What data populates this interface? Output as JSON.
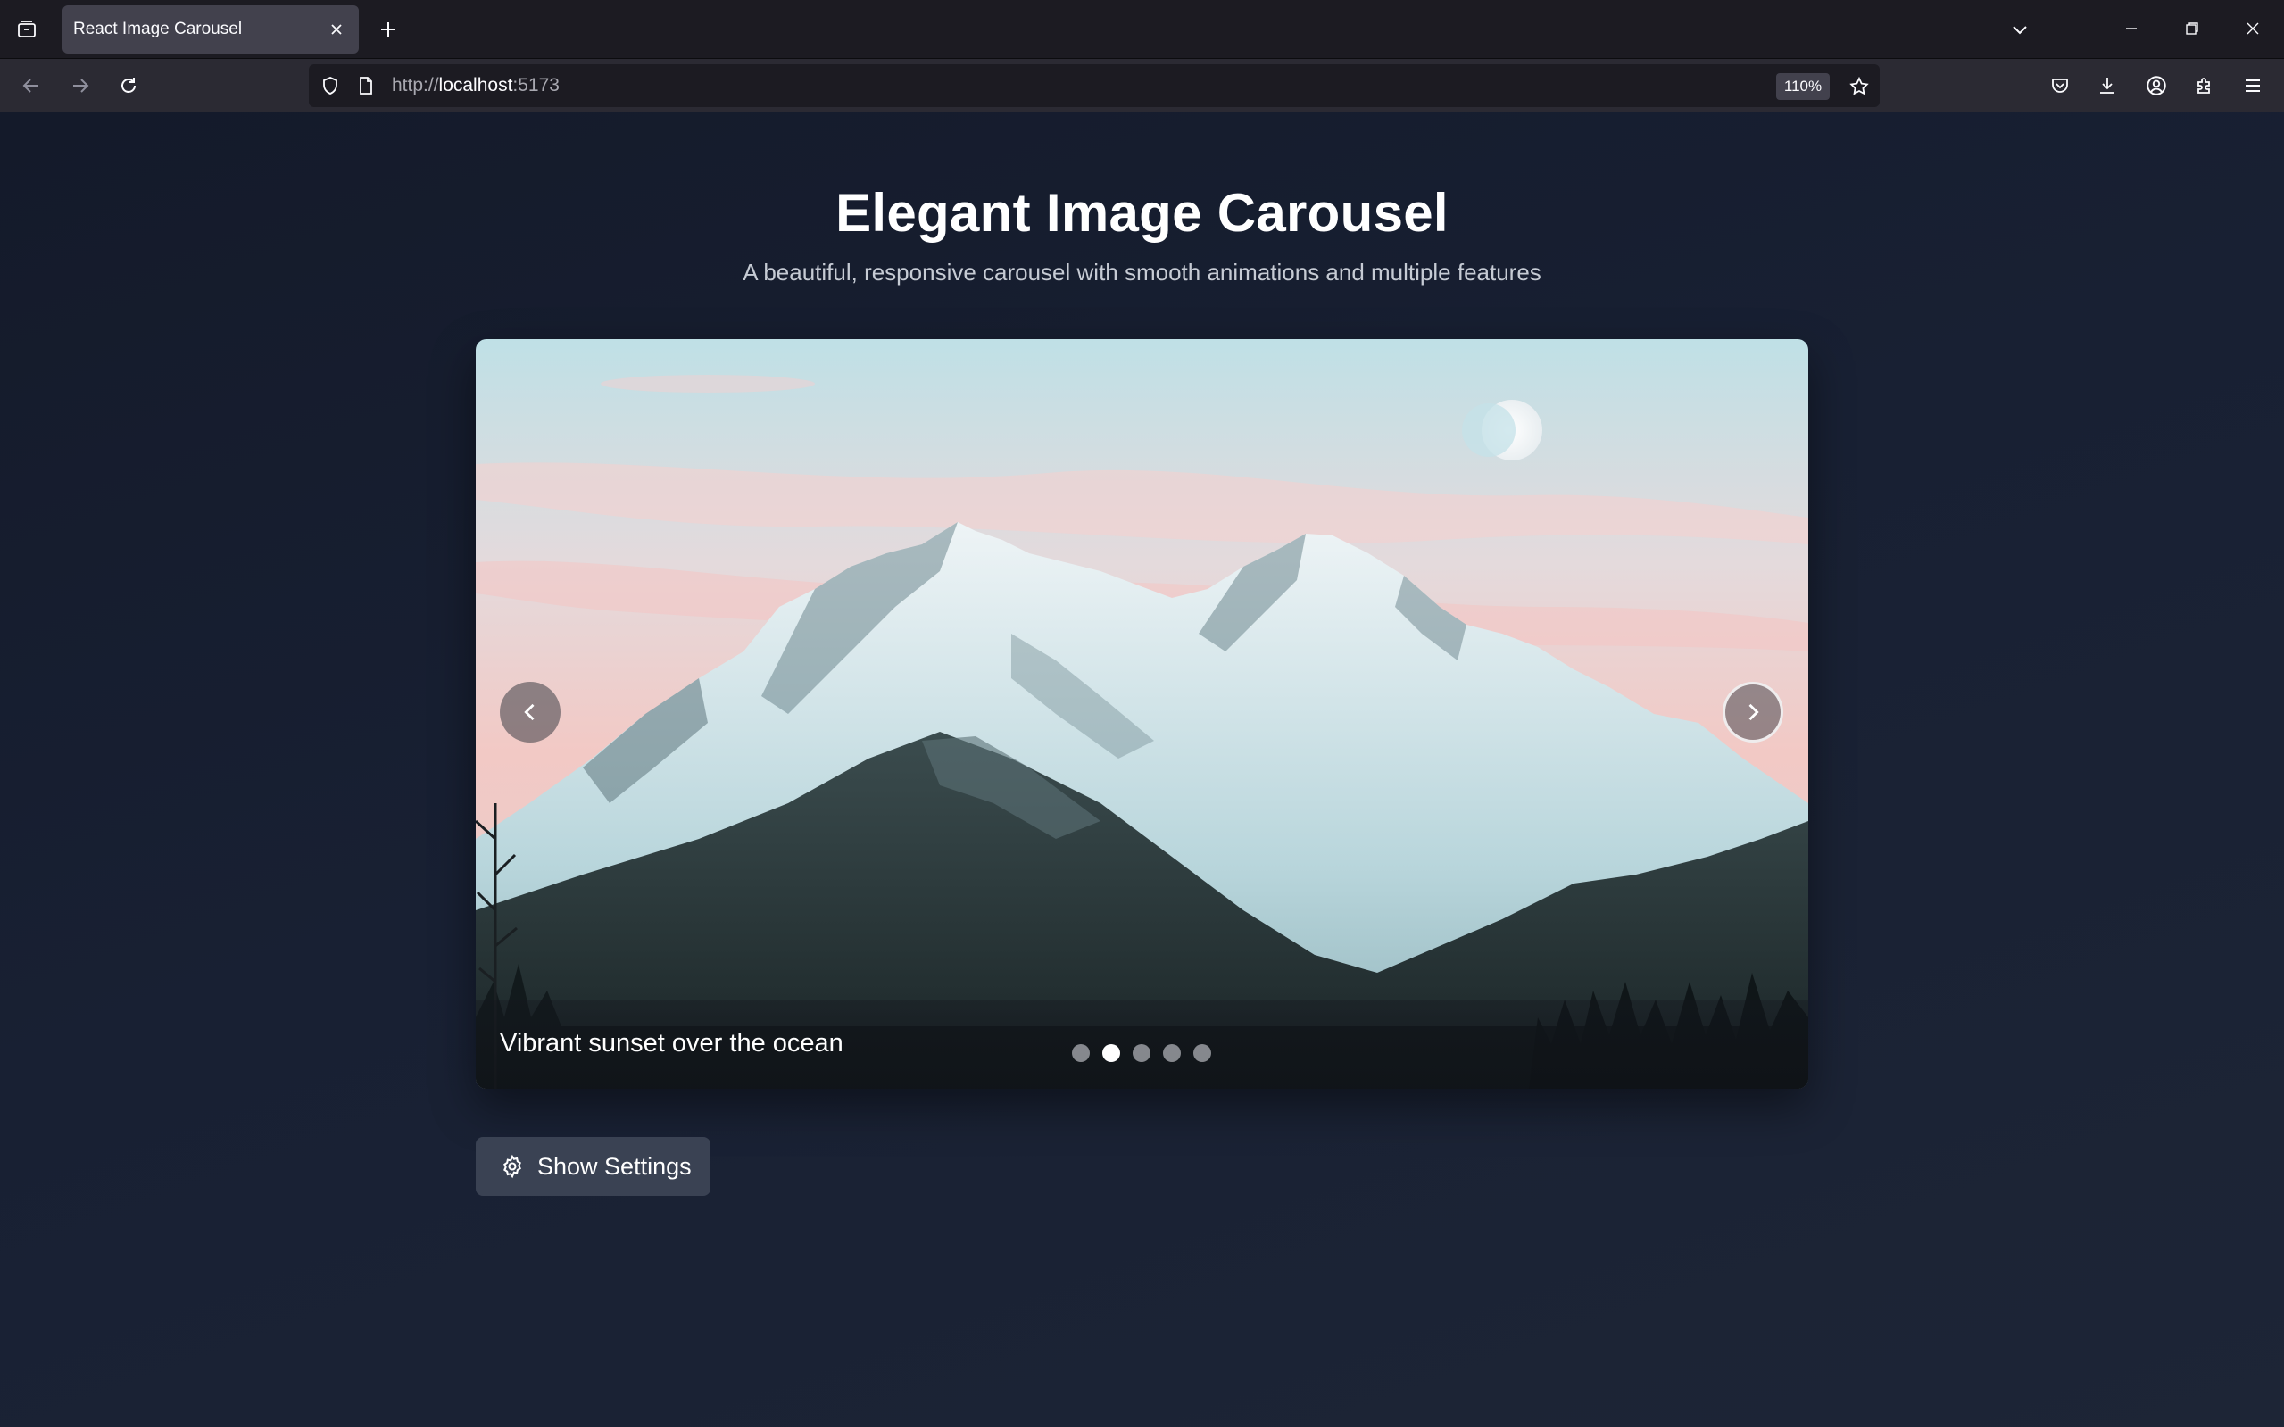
{
  "browser": {
    "tab_title": "React Image Carousel",
    "url_scheme": "http://",
    "url_host": "localhost",
    "url_port": ":5173",
    "zoom": "110%"
  },
  "page": {
    "title": "Elegant Image Carousel",
    "subtitle": "A beautiful, responsive carousel with smooth animations and multiple features"
  },
  "carousel": {
    "caption": "Vibrant sunset over the ocean",
    "slide_count": 5,
    "active_index": 1
  },
  "settings_button": {
    "label": "Show Settings"
  },
  "icons": {
    "tab_overview": "tab-overview-icon",
    "close_tab": "close-icon",
    "new_tab": "plus-icon",
    "back": "back-arrow-icon",
    "forward": "forward-arrow-icon",
    "reload": "reload-icon",
    "shield": "shield-icon",
    "page": "page-icon",
    "bookmark": "star-icon",
    "pocket": "pocket-icon",
    "downloads": "download-icon",
    "account": "account-icon",
    "extensions": "puzzle-icon",
    "menu": "hamburger-menu-icon",
    "prev_slide": "chevron-left-icon",
    "next_slide": "chevron-right-icon",
    "settings": "gear-icon"
  }
}
